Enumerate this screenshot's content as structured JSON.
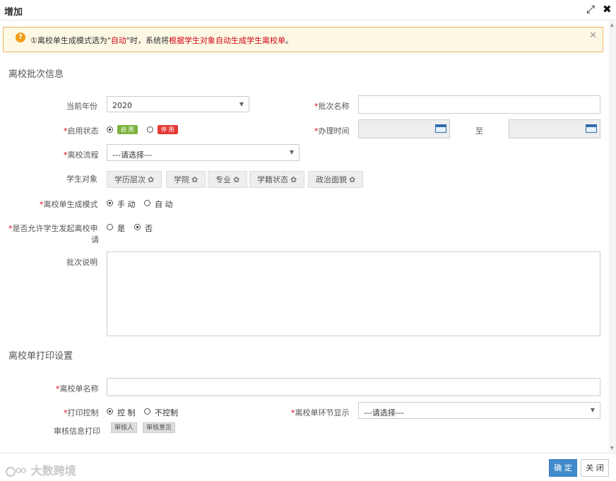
{
  "dialog": {
    "title": "增加",
    "alert": {
      "text_before": "①离校单生成模式选为\"",
      "text_mode": "自动",
      "text_middle": "\"时，系统将",
      "text_highlight": "根据学生对象自动生成学生离校单",
      "text_end": "。"
    },
    "section1": "离校批次信息",
    "section2": "离校单打印设置",
    "fields": {
      "year_label": "当前年份",
      "year_value": "2020",
      "batch_name_label": "批次名称",
      "batch_name_value": "",
      "status_label": "启用状态",
      "status_enable": "启 用",
      "status_disable": "停 用",
      "time_label": "办理时间",
      "time_to": "至",
      "time_start": "",
      "time_end": "",
      "process_label": "离校流程",
      "process_value": "---请选择---",
      "target_label": "学生对象",
      "targets": [
        "学历层次",
        "学院",
        "专业",
        "学籍状态",
        "政治面貌"
      ],
      "mode_label": "离校单生成模式",
      "mode_manual": "手 动",
      "mode_auto": "自 动",
      "allow_label_1": "是否允许学生发起离校申",
      "allow_label_2": "请",
      "allow_yes": "是",
      "allow_no": "否",
      "desc_label": "批次说明",
      "desc_value": "",
      "form_name_label": "离校单名称",
      "form_name_value": "",
      "print_label": "打印控制",
      "print_control": "控 制",
      "print_nocontrol": "不控制",
      "stage_label": "离校单环节显示",
      "stage_value": "---请选择---",
      "audit_label": "审核信息打印",
      "audit_tags": [
        "审核人",
        "审核意见"
      ]
    },
    "required_mark": "*",
    "buttons": {
      "confirm": "确 定",
      "close": "关 闭"
    },
    "watermark": "大数跨境"
  },
  "colors": {
    "enable": "#7cb342",
    "disable": "#e53935",
    "primary": "#428bca",
    "alert_border": "#f0b36a"
  }
}
